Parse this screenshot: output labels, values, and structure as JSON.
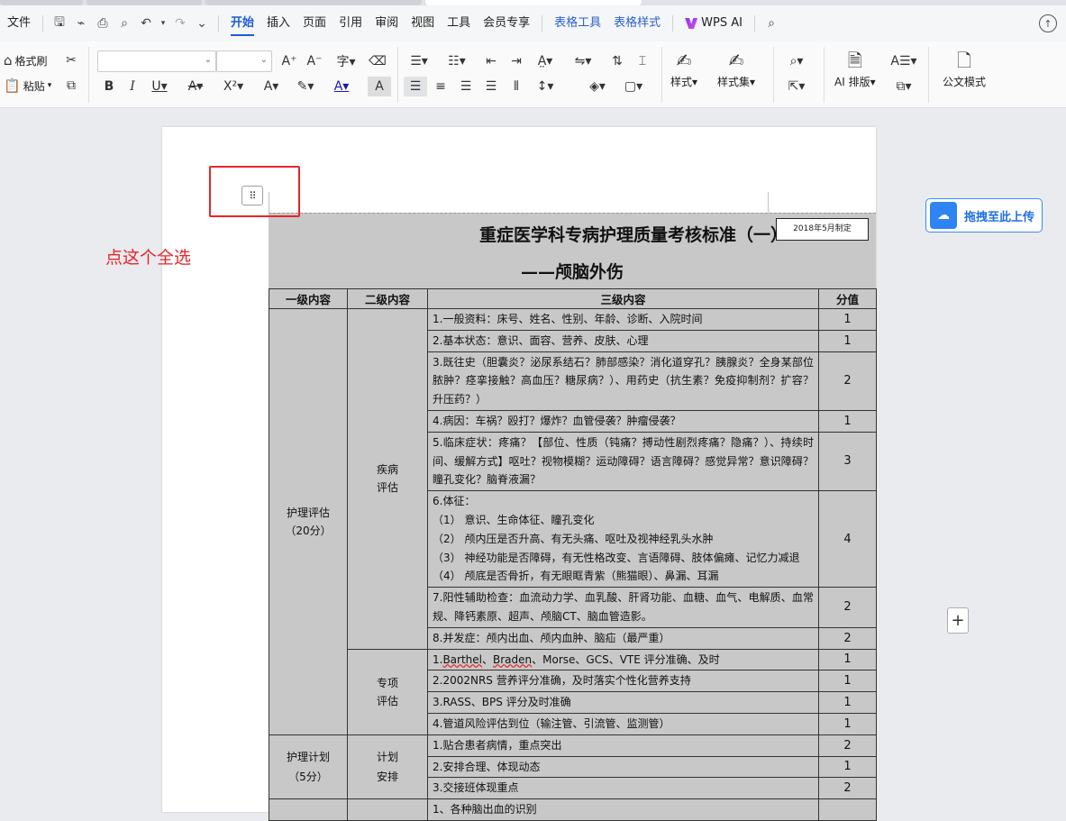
{
  "menubar": {
    "file": "文件",
    "tabs": [
      "开始",
      "插入",
      "页面",
      "引用",
      "审阅",
      "视图",
      "工具",
      "会员专享"
    ],
    "active_tab": "开始",
    "context_tabs": [
      "表格工具",
      "表格样式"
    ],
    "ai": "WPS AI"
  },
  "ribbon": {
    "format_painter": "格式刷",
    "paste": "粘贴",
    "styles": "样式",
    "style_set": "样式集",
    "ai_layout": "AI 排版",
    "official_style": "公文模式"
  },
  "doc": {
    "annotation": "点这个全选",
    "upload_button": "拖拽至此上传",
    "title_main": "重症医学科专病护理质量考核标准（一）",
    "title_date": "2018年5月制定",
    "title_sub": "——颅脑外伤",
    "headers": [
      "一级内容",
      "二级内容",
      "三级内容",
      "分值"
    ],
    "groups": {
      "nursing_assessment": "护理评估\n（20分）",
      "disease_assessment": "疾病\n评估",
      "special_assessment": "专项\n评估",
      "nursing_plan": "护理计划\n（5分）",
      "plan_arrangement": "计划\n安排"
    },
    "rows": [
      {
        "text": "1.一般资料：床号、姓名、性别、年龄、诊断、入院时间",
        "score": "1"
      },
      {
        "text": "2.基本状态：意识、面容、营养、皮肤、心理",
        "score": "1"
      },
      {
        "text": "3.既往史（胆囊炎？泌尿系结石？肺部感染？消化道穿孔？胰腺炎？全身某部位脓肿？痉挛接触？高血压？糖尿病？）、用药史（抗生素？免疫抑制剂？扩容？升压药？）",
        "score": "2"
      },
      {
        "text": "4.病因：车祸？殴打？爆炸？血管侵袭？肿瘤侵袭？",
        "score": "1"
      },
      {
        "text": "5.临床症状：疼痛？【部位、性质（钝痛？搏动性剧烈疼痛？隐痛？）、持续时间、缓解方式】呕吐？视物模糊？运动障碍？语言障碍？感觉异常？意识障碍？瞳孔变化？脑脊液漏？",
        "score": "3"
      },
      {
        "text": "6.体征：\n（1） 意识、生命体征、瞳孔变化\n（2） 颅内压是否升高、有无头痛、呕吐及视神经乳头水肿\n（3） 神经功能是否障碍，有无性格改变、言语障碍、肢体偏瘫、记忆力减退\n（4） 颅底是否骨折，有无眼眶青紫（熊猫眼）、鼻漏、耳漏",
        "score": "4"
      },
      {
        "text": "7.阳性辅助检查：血流动力学、血乳酸、肝肾功能、血糖、血气、电解质、血常规、降钙素原、超声、颅脑CT、脑血管造影。",
        "score": "2"
      },
      {
        "text": "8.并发症：颅内出血、颅内血肿、脑疝（最严重）",
        "score": "2"
      },
      {
        "text_a": "1.",
        "text_u1": "Barthel",
        "text_b": "、",
        "text_u2": "Braden",
        "text_c": "、Morse、GCS、VTE 评分准确、及时",
        "score": "1"
      },
      {
        "text": "2.2002NRS 营养评分准确，及时落实个性化营养支持",
        "score": "1"
      },
      {
        "text": "3.RASS、BPS 评分及时准确",
        "score": "1"
      },
      {
        "text": "4.管道风险评估到位（输注管、引流管、监测管）",
        "score": "1"
      },
      {
        "text": "1.贴合患者病情，重点突出",
        "score": "2"
      },
      {
        "text": "2.安排合理、体现动态",
        "score": "1"
      },
      {
        "text": "3.交接班体现重点",
        "score": "2"
      },
      {
        "text": "1、各种脑出血的识别",
        "score": ""
      }
    ]
  }
}
